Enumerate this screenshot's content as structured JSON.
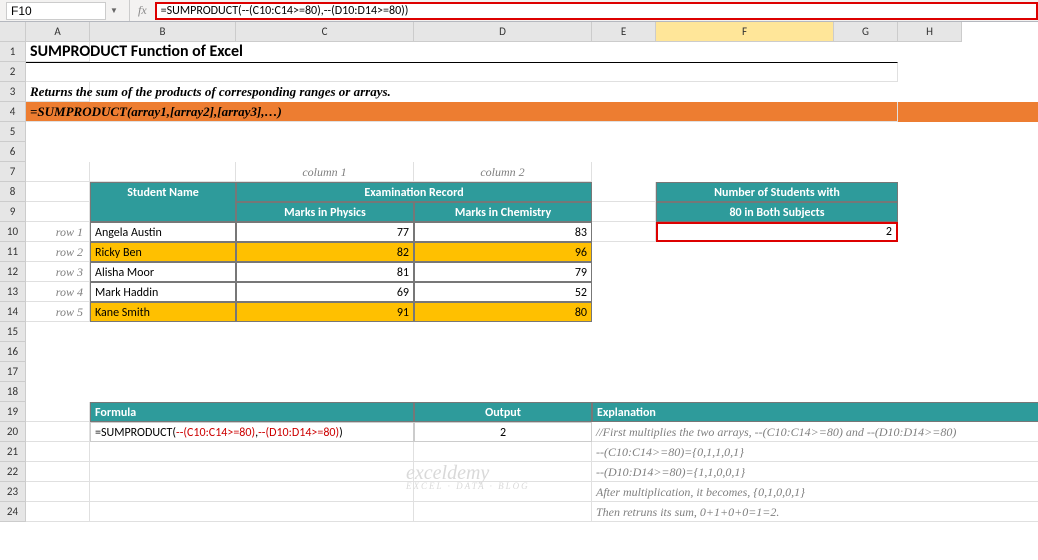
{
  "name_box": "F10",
  "formula_bar": "=SUMPRODUCT(--(C10:C14>=80),--(D10:D14>=80))",
  "fx_label": "fx",
  "columns": [
    "A",
    "B",
    "C",
    "D",
    "E",
    "F",
    "G",
    "H"
  ],
  "row_numbers": [
    "1",
    "2",
    "3",
    "4",
    "5",
    "6",
    "7",
    "8",
    "9",
    "10",
    "11",
    "12",
    "13",
    "14",
    "15",
    "16",
    "17",
    "18",
    "19",
    "20",
    "21",
    "22",
    "23",
    "24"
  ],
  "title": "SUMPRODUCT Function of Excel",
  "desc": "Returns the sum of the products of corresponding ranges or arrays.",
  "syntax": "=SUMPRODUCT(array1,[array2],[array3],…)",
  "col_label1": "column 1",
  "col_label2": "column 2",
  "row_labels": [
    "row 1",
    "row 2",
    "row 3",
    "row 4",
    "row 5"
  ],
  "table": {
    "student_name_hdr": "Student Name",
    "exam_hdr": "Examination Record",
    "phys_hdr": "Marks in Physics",
    "chem_hdr": "Marks in Chemistry",
    "rows": [
      {
        "name": "Angela Austin",
        "phys": "77",
        "chem": "83"
      },
      {
        "name": "Ricky Ben",
        "phys": "82",
        "chem": "96"
      },
      {
        "name": "Alisha Moor",
        "phys": "81",
        "chem": "79"
      },
      {
        "name": "Mark Haddin",
        "phys": "69",
        "chem": "52"
      },
      {
        "name": "Kane Smith",
        "phys": "91",
        "chem": "80"
      }
    ]
  },
  "result": {
    "hdr1": "Number of Students with",
    "hdr2": "80 in Both Subjects",
    "value": "2"
  },
  "section": {
    "formula_hdr": "Formula",
    "output_hdr": "Output",
    "expl_hdr": "Explanation",
    "formula_l": "=SUMPRODUCT(",
    "formula_r1": "--(C10:C14>=80)",
    "formula_c": ",",
    "formula_r2": "--(D10:D14>=80)",
    "formula_e": ")",
    "output_val": "2",
    "expl_lines": [
      "//First multiplies the two arrays, --(C10:C14>=80) and --(D10:D14>=80)",
      "--(C10:C14>=80)={0,1,1,0,1}",
      "--(D10:D14>=80)={1,1,0,0,1}",
      "After multiplication, it becomes, {0,1,0,0,1}",
      "Then retruns its sum, 0+1+0+0=1=2."
    ]
  },
  "watermark": {
    "brand": "exceldemy",
    "tag": "EXCEL · DATA · BLOG"
  },
  "chart_data": {
    "type": "table",
    "title": "Examination Record",
    "columns": [
      "Student Name",
      "Marks in Physics",
      "Marks in Chemistry"
    ],
    "rows": [
      [
        "Angela Austin",
        77,
        83
      ],
      [
        "Ricky Ben",
        82,
        96
      ],
      [
        "Alisha Moor",
        81,
        79
      ],
      [
        "Mark Haddin",
        69,
        52
      ],
      [
        "Kane Smith",
        91,
        80
      ]
    ],
    "derived": {
      "label": "Number of Students with 80 in Both Subjects",
      "value": 2
    }
  }
}
